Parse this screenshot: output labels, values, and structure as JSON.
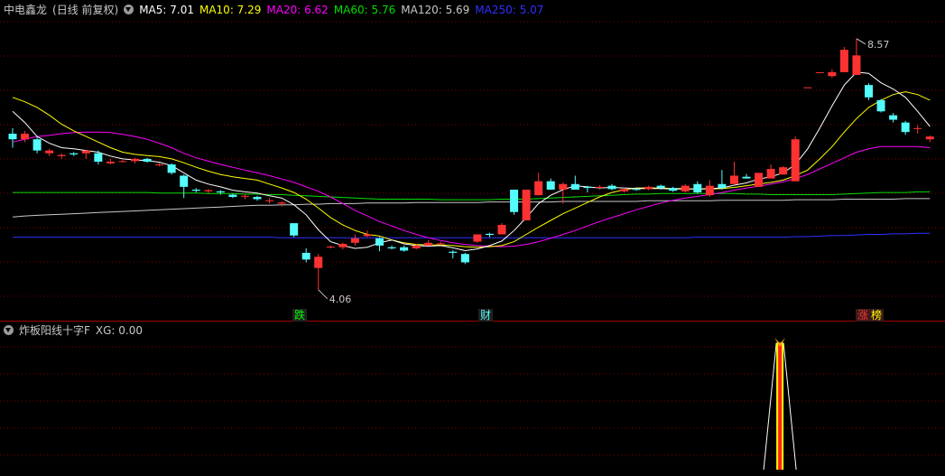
{
  "main_header": {
    "stock": "中电鑫龙",
    "period": "(日线 前复权)",
    "indicators": [
      {
        "label": "MA5: 7.01",
        "color": "#ffffff"
      },
      {
        "label": "MA10: 7.29",
        "color": "#ffff00"
      },
      {
        "label": "MA20: 6.62",
        "color": "#ff00ff"
      },
      {
        "label": "MA60: 5.76",
        "color": "#00e000"
      },
      {
        "label": "MA120: 5.69",
        "color": "#c8c8c8"
      },
      {
        "label": "MA250: 5.07",
        "color": "#3030ff"
      }
    ]
  },
  "sub_header": {
    "name": "炸板阳线十字F",
    "indicators": [
      {
        "label": "XG: 0.00",
        "color": "#c8c8c8"
      }
    ]
  },
  "markers": {
    "low_label": "4.06",
    "high_label": "8.57",
    "event_1": "跌",
    "event_2": "财",
    "event_3": "涨",
    "event_4": "榜"
  },
  "colors": {
    "up": "#ff3232",
    "down": "#54fcfc",
    "grid": "#800000",
    "signal": "#ffff00"
  },
  "chart_data": {
    "type": "candlestick",
    "ohlc": [
      [
        6.85,
        6.75,
        6.95,
        6.6
      ],
      [
        6.75,
        6.85,
        6.9,
        6.7
      ],
      [
        6.75,
        6.55,
        6.8,
        6.5
      ],
      [
        6.5,
        6.55,
        6.58,
        6.45
      ],
      [
        6.45,
        6.47,
        6.5,
        6.4
      ],
      [
        6.5,
        6.48,
        6.52,
        6.45
      ],
      [
        6.5,
        6.55,
        6.55,
        6.4
      ],
      [
        6.5,
        6.35,
        6.55,
        6.3
      ],
      [
        6.32,
        6.35,
        6.4,
        6.3
      ],
      [
        6.36,
        6.36,
        6.38,
        6.34
      ],
      [
        6.36,
        6.4,
        6.42,
        6.32
      ],
      [
        6.4,
        6.35,
        6.42,
        6.33
      ],
      [
        6.3,
        6.3,
        6.33,
        6.27
      ],
      [
        6.3,
        6.15,
        6.32,
        6.12
      ],
      [
        6.1,
        5.9,
        6.12,
        5.7
      ],
      [
        5.85,
        5.83,
        5.88,
        5.8
      ],
      [
        5.82,
        5.84,
        5.86,
        5.78
      ],
      [
        5.82,
        5.8,
        5.84,
        5.76
      ],
      [
        5.76,
        5.72,
        5.78,
        5.7
      ],
      [
        5.74,
        5.74,
        5.76,
        5.68
      ],
      [
        5.72,
        5.68,
        5.74,
        5.65
      ],
      [
        5.66,
        5.66,
        5.7,
        5.6
      ],
      [
        5.6,
        5.62,
        5.64,
        5.55
      ],
      [
        5.25,
        5.03,
        5.25,
        5.0
      ],
      [
        4.72,
        4.6,
        4.8,
        4.55
      ],
      [
        4.45,
        4.65,
        4.7,
        4.06
      ],
      [
        4.82,
        4.83,
        4.85,
        4.8
      ],
      [
        4.82,
        4.88,
        4.9,
        4.78
      ],
      [
        4.9,
        4.98,
        5.05,
        4.85
      ],
      [
        5.02,
        5.05,
        5.12,
        5.0
      ],
      [
        4.98,
        4.85,
        5.0,
        4.75
      ],
      [
        4.82,
        4.8,
        4.85,
        4.78
      ],
      [
        4.82,
        4.76,
        4.85,
        4.74
      ],
      [
        4.8,
        4.85,
        4.88,
        4.78
      ],
      [
        4.85,
        4.9,
        4.95,
        4.85
      ],
      [
        4.88,
        4.89,
        4.92,
        4.86
      ],
      [
        4.74,
        4.72,
        4.77,
        4.62
      ],
      [
        4.7,
        4.55,
        4.72,
        4.52
      ],
      [
        4.92,
        5.05,
        5.05,
        4.9
      ],
      [
        5.06,
        5.04,
        5.08,
        5.0
      ],
      [
        5.05,
        5.22,
        5.25,
        5.05
      ],
      [
        5.85,
        5.45,
        5.85,
        5.4
      ],
      [
        5.3,
        5.85,
        5.85,
        5.3
      ],
      [
        5.75,
        6.0,
        6.15,
        5.75
      ],
      [
        6.0,
        5.85,
        6.05,
        5.85
      ],
      [
        5.85,
        5.95,
        5.98,
        5.6
      ],
      [
        5.95,
        5.85,
        6.1,
        5.85
      ],
      [
        5.9,
        5.88,
        5.92,
        5.8
      ],
      [
        5.88,
        5.9,
        5.93,
        5.85
      ],
      [
        5.92,
        5.86,
        5.95,
        5.84
      ],
      [
        5.82,
        5.86,
        5.88,
        5.8
      ],
      [
        5.86,
        5.85,
        5.88,
        5.83
      ],
      [
        5.86,
        5.9,
        5.92,
        5.84
      ],
      [
        5.92,
        5.88,
        5.94,
        5.85
      ],
      [
        5.88,
        5.83,
        5.9,
        5.81
      ],
      [
        5.82,
        5.92,
        5.95,
        5.8
      ],
      [
        5.95,
        5.8,
        6.0,
        5.78
      ],
      [
        5.75,
        5.92,
        6.02,
        5.72
      ],
      [
        5.95,
        5.88,
        6.2,
        5.85
      ],
      [
        5.95,
        6.1,
        6.35,
        5.95
      ],
      [
        6.08,
        6.05,
        6.13,
        6.05
      ],
      [
        5.9,
        6.15,
        6.15,
        5.9
      ],
      [
        6.05,
        6.22,
        6.3,
        6.05
      ],
      [
        6.12,
        6.25,
        6.27,
        6.12
      ],
      [
        6.0,
        6.75,
        6.8,
        6.0
      ],
      [
        7.68,
        7.68,
        7.68,
        7.68
      ],
      [
        7.95,
        7.95,
        7.95,
        7.95
      ],
      [
        7.88,
        7.95,
        8.0,
        7.85
      ],
      [
        7.95,
        8.35,
        8.4,
        7.95
      ],
      [
        7.9,
        8.25,
        8.55,
        7.9
      ],
      [
        7.72,
        7.5,
        7.75,
        7.45
      ],
      [
        7.45,
        7.25,
        7.47,
        7.23
      ],
      [
        7.18,
        7.1,
        7.22,
        7.05
      ],
      [
        7.05,
        6.88,
        7.08,
        6.83
      ],
      [
        6.95,
        6.95,
        7.0,
        6.85
      ],
      [
        6.75,
        6.8,
        6.82,
        6.7
      ]
    ],
    "ma5": [
      7.25,
      7.05,
      6.8,
      6.68,
      6.6,
      6.58,
      6.55,
      6.52,
      6.45,
      6.4,
      6.38,
      6.37,
      6.34,
      6.28,
      6.15,
      6.02,
      5.95,
      5.9,
      5.84,
      5.81,
      5.79,
      5.74,
      5.7,
      5.58,
      5.4,
      5.13,
      4.92,
      4.85,
      4.8,
      4.82,
      4.9,
      4.95,
      4.88,
      4.85,
      4.84,
      4.85,
      4.81,
      4.76,
      4.79,
      4.85,
      4.93,
      5.12,
      5.35,
      5.6,
      5.75,
      5.85,
      5.92,
      5.9,
      5.88,
      5.89,
      5.88,
      5.87,
      5.87,
      5.87,
      5.86,
      5.86,
      5.86,
      5.87,
      5.88,
      5.93,
      5.97,
      6.04,
      6.08,
      6.15,
      6.3,
      6.58,
      6.95,
      7.35,
      7.72,
      7.95,
      7.93,
      7.76,
      7.65,
      7.5,
      7.25,
      6.98
    ],
    "ma10": [
      7.5,
      7.42,
      7.32,
      7.18,
      7.02,
      6.9,
      6.8,
      6.7,
      6.6,
      6.52,
      6.48,
      6.46,
      6.44,
      6.4,
      6.33,
      6.25,
      6.18,
      6.12,
      6.08,
      6.05,
      6.02,
      5.95,
      5.88,
      5.8,
      5.68,
      5.52,
      5.35,
      5.22,
      5.12,
      5.05,
      5.02,
      4.95,
      4.9,
      4.87,
      4.86,
      4.86,
      4.85,
      4.83,
      4.82,
      4.83,
      4.85,
      4.92,
      5.05,
      5.18,
      5.3,
      5.42,
      5.52,
      5.62,
      5.72,
      5.8,
      5.85,
      5.88,
      5.88,
      5.88,
      5.87,
      5.87,
      5.86,
      5.86,
      5.87,
      5.89,
      5.92,
      5.95,
      5.98,
      6.02,
      6.1,
      6.2,
      6.4,
      6.62,
      6.88,
      7.12,
      7.32,
      7.45,
      7.55,
      7.6,
      7.55,
      7.45
    ],
    "ma20": [
      6.7,
      6.75,
      6.8,
      6.82,
      6.85,
      6.87,
      6.88,
      6.88,
      6.87,
      6.84,
      6.8,
      6.75,
      6.68,
      6.6,
      6.5,
      6.42,
      6.36,
      6.3,
      6.25,
      6.2,
      6.15,
      6.1,
      6.04,
      5.98,
      5.9,
      5.82,
      5.72,
      5.6,
      5.48,
      5.38,
      5.28,
      5.2,
      5.12,
      5.05,
      4.99,
      4.94,
      4.9,
      4.87,
      4.85,
      4.84,
      4.83,
      4.84,
      4.87,
      4.92,
      4.98,
      5.05,
      5.12,
      5.2,
      5.28,
      5.35,
      5.42,
      5.49,
      5.55,
      5.61,
      5.66,
      5.7,
      5.73,
      5.76,
      5.8,
      5.84,
      5.88,
      5.91,
      5.95,
      5.99,
      6.05,
      6.12,
      6.22,
      6.32,
      6.42,
      6.52,
      6.58,
      6.62,
      6.62,
      6.62,
      6.62,
      6.6
    ],
    "ma60": [
      5.8,
      5.8,
      5.8,
      5.8,
      5.8,
      5.8,
      5.8,
      5.8,
      5.8,
      5.8,
      5.8,
      5.8,
      5.79,
      5.79,
      5.79,
      5.79,
      5.78,
      5.78,
      5.78,
      5.77,
      5.77,
      5.76,
      5.76,
      5.75,
      5.74,
      5.73,
      5.72,
      5.71,
      5.7,
      5.69,
      5.68,
      5.68,
      5.68,
      5.68,
      5.68,
      5.67,
      5.67,
      5.67,
      5.67,
      5.67,
      5.68,
      5.68,
      5.68,
      5.69,
      5.7,
      5.71,
      5.72,
      5.73,
      5.74,
      5.75,
      5.76,
      5.77,
      5.77,
      5.78,
      5.78,
      5.78,
      5.78,
      5.78,
      5.78,
      5.78,
      5.77,
      5.77,
      5.76,
      5.76,
      5.76,
      5.76,
      5.76,
      5.76,
      5.77,
      5.78,
      5.79,
      5.8,
      5.8,
      5.8,
      5.81,
      5.81
    ],
    "ma120": [
      5.36,
      5.38,
      5.39,
      5.4,
      5.41,
      5.42,
      5.43,
      5.44,
      5.45,
      5.46,
      5.47,
      5.48,
      5.49,
      5.5,
      5.51,
      5.52,
      5.53,
      5.54,
      5.55,
      5.56,
      5.57,
      5.57,
      5.58,
      5.58,
      5.59,
      5.59,
      5.6,
      5.6,
      5.6,
      5.61,
      5.61,
      5.61,
      5.61,
      5.62,
      5.62,
      5.62,
      5.62,
      5.62,
      5.62,
      5.63,
      5.63,
      5.63,
      5.63,
      5.63,
      5.63,
      5.64,
      5.64,
      5.64,
      5.64,
      5.64,
      5.64,
      5.64,
      5.65,
      5.65,
      5.65,
      5.65,
      5.65,
      5.65,
      5.66,
      5.66,
      5.66,
      5.66,
      5.66,
      5.66,
      5.67,
      5.67,
      5.67,
      5.67,
      5.68,
      5.68,
      5.68,
      5.68,
      5.68,
      5.69,
      5.69,
      5.69
    ],
    "ma250": [
      5.0,
      5.0,
      5.0,
      5.0,
      5.0,
      5.0,
      5.0,
      5.0,
      5.0,
      5.0,
      5.0,
      5.0,
      5.0,
      5.0,
      5.0,
      5.0,
      5.0,
      5.0,
      5.0,
      5.0,
      5.0,
      5.0,
      4.99,
      4.99,
      4.99,
      4.99,
      4.99,
      4.99,
      4.99,
      4.99,
      4.99,
      4.99,
      4.99,
      4.99,
      4.99,
      4.99,
      4.99,
      4.99,
      4.99,
      4.99,
      4.99,
      4.99,
      4.99,
      4.99,
      4.99,
      4.99,
      4.99,
      4.99,
      4.99,
      4.99,
      4.99,
      4.99,
      4.99,
      4.99,
      4.99,
      4.99,
      5.0,
      5.0,
      5.0,
      5.0,
      5.0,
      5.0,
      5.0,
      5.0,
      5.01,
      5.01,
      5.02,
      5.03,
      5.03,
      5.04,
      5.05,
      5.05,
      5.06,
      5.06,
      5.07,
      5.07
    ],
    "xg": [
      0,
      0,
      0,
      0,
      0,
      0,
      0,
      0,
      0,
      0,
      0,
      0,
      0,
      0,
      0,
      0,
      0,
      0,
      0,
      0,
      0,
      0,
      0,
      0,
      0,
      0,
      0,
      0,
      0,
      0,
      0,
      0,
      0,
      0,
      0,
      0,
      0,
      0,
      0,
      0,
      0,
      0,
      0,
      0,
      0,
      0,
      0,
      0,
      0,
      0,
      0,
      0,
      0,
      0,
      0,
      0,
      0,
      0,
      0,
      0,
      0,
      0,
      1,
      0,
      0,
      0,
      0,
      0,
      0,
      0,
      0,
      0,
      0,
      0,
      0,
      0
    ],
    "price_range": [
      3.75,
      8.95
    ]
  }
}
